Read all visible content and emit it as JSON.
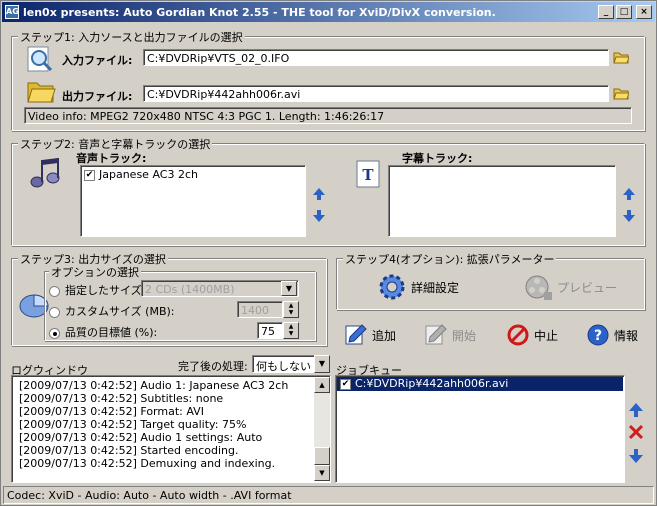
{
  "window": {
    "title": "len0x presents: Auto Gordian Knot 2.55 - THE tool for XviD/DivX conversion."
  },
  "step1": {
    "legend": "ステップ1: 入力ソースと出力ファイルの選択",
    "input_label": "入力ファイル:",
    "input_value": "C:¥DVDRip¥VTS_02_0.IFO",
    "output_label": "出力ファイル:",
    "output_value": "C:¥DVDRip¥442ahh006r.avi",
    "video_info": "Video info: MPEG2 720x480 NTSC 4:3    PGC 1. Length: 1:46:26:17"
  },
  "step2": {
    "legend": "ステップ2: 音声と字幕トラックの選択",
    "audio_label": "音声トラック:",
    "audio_items": [
      {
        "label": "Japanese AC3 2ch",
        "checked": true
      }
    ],
    "subtitle_label": "字幕トラック:"
  },
  "step3": {
    "legend": "ステップ3: 出力サイズの選択",
    "options_legend": "オプションの選択",
    "size_label": "指定したサイズ:",
    "size_value": "2 CDs (1400MB)",
    "custom_label": "カスタムサイズ (MB):",
    "custom_value": "1400",
    "quality_label": "品質の目標値 (%):",
    "quality_value": "75",
    "selected": "quality"
  },
  "step4": {
    "legend": "ステップ4(オプション): 拡張パラメーター",
    "advanced_label": "詳細設定",
    "preview_label": "プレビュー"
  },
  "actions": {
    "add_label": "追加",
    "start_label": "開始",
    "stop_label": "中止",
    "info_label": "情報"
  },
  "log": {
    "title": "ログウィンドウ",
    "after_label": "完了後の処理:",
    "after_value": "何もしない",
    "lines": [
      "[2009/07/13 0:42:52] Audio 1: Japanese AC3 2ch",
      "[2009/07/13 0:42:52] Subtitles: none",
      "[2009/07/13 0:42:52] Format: AVI",
      "[2009/07/13 0:42:52] Target quality: 75%",
      "[2009/07/13 0:42:52] Audio 1 settings: Auto",
      "[2009/07/13 0:42:52] Started encoding.",
      "[2009/07/13 0:42:52] Demuxing and indexing."
    ]
  },
  "queue": {
    "title": "ジョブキュー",
    "items": [
      {
        "label": "C:¥DVDRip¥442ahh006r.avi",
        "checked": true,
        "selected": true
      }
    ]
  },
  "status": "Codec: XviD -   Audio: Auto -   Auto width - .AVI format",
  "colors": {
    "title_bar": "#0a246a",
    "window_bg": "#d4d0c8",
    "arrow_blue": "#2a62c8",
    "delete_red": "#cc2020",
    "stop_red": "#d01818"
  }
}
